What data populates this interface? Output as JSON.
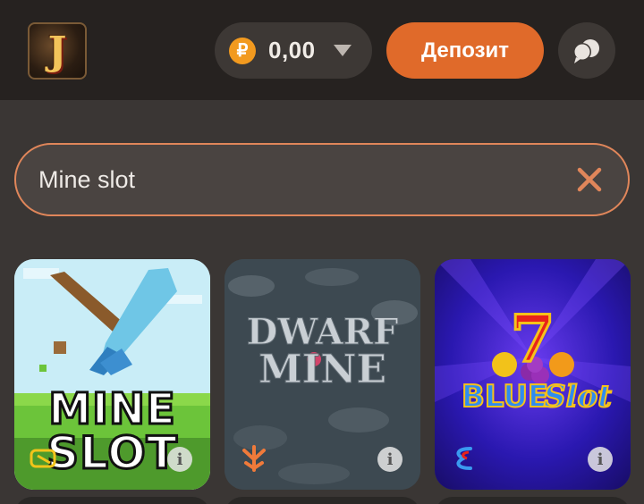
{
  "header": {
    "logo_letter": "J",
    "currency_symbol": "₽",
    "balance": "0,00",
    "deposit_label": "Депозит",
    "icons": [
      "dropdown-chevron-icon",
      "support-chat-icon"
    ]
  },
  "search": {
    "value": "Mine slot",
    "clear_icon": "close-icon"
  },
  "games": [
    {
      "title_line1": "MINE",
      "title_line2": "SLOT",
      "provider_icon": "provider-logo-icon",
      "info_icon": "info-icon"
    },
    {
      "title_line1": "DWARF",
      "title_line2": "MINE",
      "provider_icon": "yggdrasil-logo-icon",
      "info_icon": "info-icon"
    },
    {
      "title_line1": "7",
      "title_line2": "BLUE",
      "title_line3": "Slot",
      "provider_icon": "provider-logo-icon",
      "info_icon": "info-icon"
    }
  ],
  "colors": {
    "accent": "#e06a2a",
    "header_bg": "#262220",
    "page_bg": "#3a3634"
  }
}
